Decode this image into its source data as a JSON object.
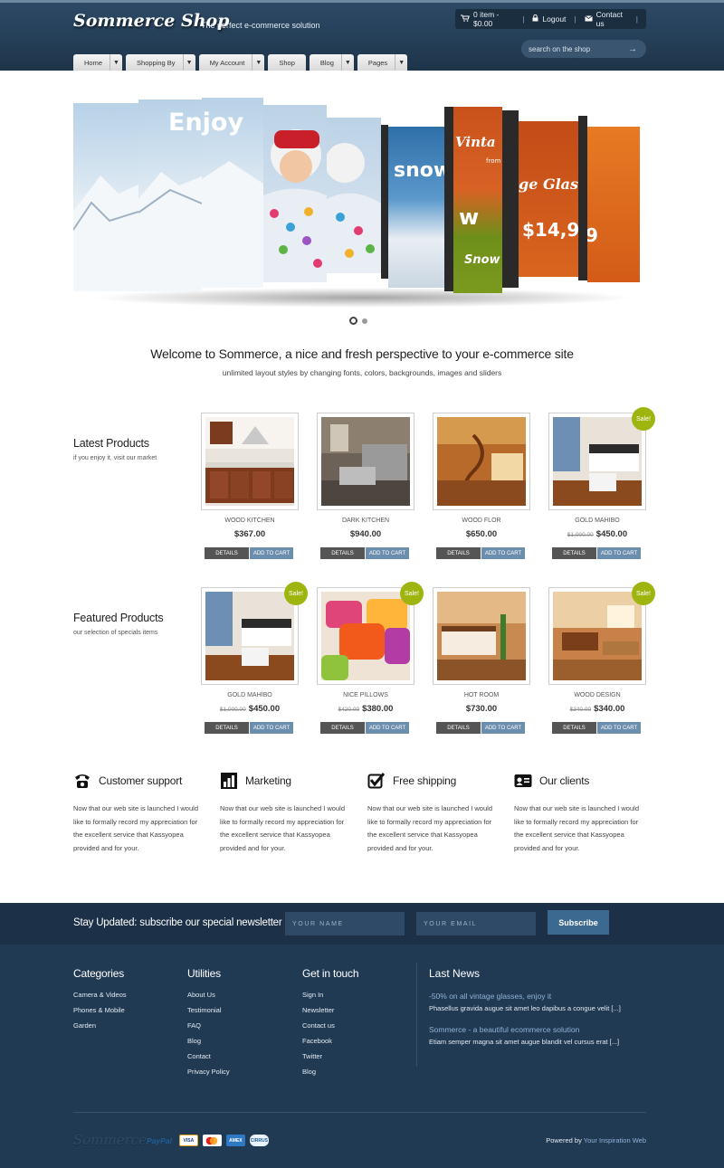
{
  "header": {
    "logo": "Sommerce Shop",
    "tagline": "The perfect e-commerce solution",
    "cart": "0 item - $0.00",
    "logout": "Logout",
    "contact": "Contact us",
    "search_placeholder": "search on the shop"
  },
  "nav": {
    "home": "Home",
    "shopping_by": "Shopping By",
    "my_account": "My Account",
    "shop": "Shop",
    "blog": "Blog",
    "pages": "Pages"
  },
  "slider": {
    "enjoy": "Enjoy",
    "snow": "snow",
    "vinta": "Vinta",
    "from": "from",
    "glasses": "ge Glasses",
    "price": "$14,9",
    "nine": "9",
    "snow2": "Snow",
    "w": "w"
  },
  "welcome": {
    "title": "Welcome to Sommerce, a nice and fresh perspective to your e-commerce site",
    "subtitle": "unlimited layout styles by changing fonts, colors, backgrounds, images and sliders"
  },
  "latest": {
    "title": "Latest Products",
    "subtitle": "if you enjoy it, visit our market",
    "products": [
      {
        "name": "WOOD KITCHEN",
        "old": "",
        "price": "$367.00",
        "sale": ""
      },
      {
        "name": "DARK KITCHEN",
        "old": "",
        "price": "$940.00",
        "sale": ""
      },
      {
        "name": "WOOD FLOR",
        "old": "",
        "price": "$650.00",
        "sale": ""
      },
      {
        "name": "GOLD MAHIBO",
        "old": "$1,000.00",
        "price": "$450.00",
        "sale": "Sale!"
      }
    ]
  },
  "featured": {
    "title": "Featured Products",
    "subtitle": "our selection of specials items",
    "products": [
      {
        "name": "GOLD MAHIBO",
        "old": "$1,000.00",
        "price": "$450.00",
        "sale": "Sale!"
      },
      {
        "name": "NICE PILLOWS",
        "old": "$420.00",
        "price": "$380.00",
        "sale": "Sale!"
      },
      {
        "name": "HOT ROOM",
        "old": "",
        "price": "$730.00",
        "sale": ""
      },
      {
        "name": "WOOD DESIGN",
        "old": "$340.00",
        "price": "$340.00",
        "sale": "Sale!"
      }
    ]
  },
  "buttons": {
    "details": "DETAILS",
    "add_to_cart": "ADD TO CART"
  },
  "features": [
    {
      "title": "Customer support",
      "icon": "phone-icon",
      "text": "Now that our web site is launched I would like to formally record my appreciation for the excellent service that Kassyopea provided and for your."
    },
    {
      "title": "Marketing",
      "icon": "bar-chart-icon",
      "text": "Now that our web site is launched I would like to formally record my appreciation for the excellent service that Kassyopea provided and for your."
    },
    {
      "title": "Free shipping",
      "icon": "checkbox-icon",
      "text": "Now that our web site is launched I would like to formally record my appreciation for the excellent service that Kassyopea provided and for your."
    },
    {
      "title": "Our clients",
      "icon": "id-card-icon",
      "text": "Now that our web site is launched I would like to formally record my appreciation for the excellent service that Kassyopea provided and for your."
    }
  ],
  "newsletter": {
    "title": "Stay Updated: subscribe our special newsletter",
    "name_placeholder": "YOUR NAME",
    "email_placeholder": "YOUR EMAIL",
    "button": "Subscribe"
  },
  "footer": {
    "categories": {
      "title": "Categories",
      "items": [
        "Camera & Videos",
        "Phones & Mobile",
        "Garden"
      ]
    },
    "utilities": {
      "title": "Utilities",
      "items": [
        "About Us",
        "Testimonial",
        "FAQ",
        "Blog",
        "Contact",
        "Privacy Policy"
      ]
    },
    "touch": {
      "title": "Get in touch",
      "items": [
        "Sign In",
        "Newsletter",
        "Contact us",
        "Facebook",
        "Twitter",
        "Blog"
      ]
    },
    "news": {
      "title": "Last News",
      "items": [
        {
          "title": "-50% on all vintage glasses, enjoy it",
          "body": "Phasellus gravida augue sit amet leo dapibus a congue velit [...]"
        },
        {
          "title": "Sommerce - a beautiful ecommerce solution",
          "body": "Etiam semper magna sit amet augue blandit vel cursus erat [...]"
        }
      ]
    },
    "brand": "Sommerce",
    "paypal": "PayPal",
    "cards": [
      "VISA",
      "MC",
      "AMEX",
      "CIRRUS"
    ],
    "powered_prefix": "Powered by",
    "powered_link": "Your Inspiration Web"
  },
  "colors": {
    "header": "#243e57",
    "accent": "#6b8eae",
    "sale_badge": "#9fb50f",
    "footer": "#213a54",
    "newsletter": "#1c3047"
  }
}
